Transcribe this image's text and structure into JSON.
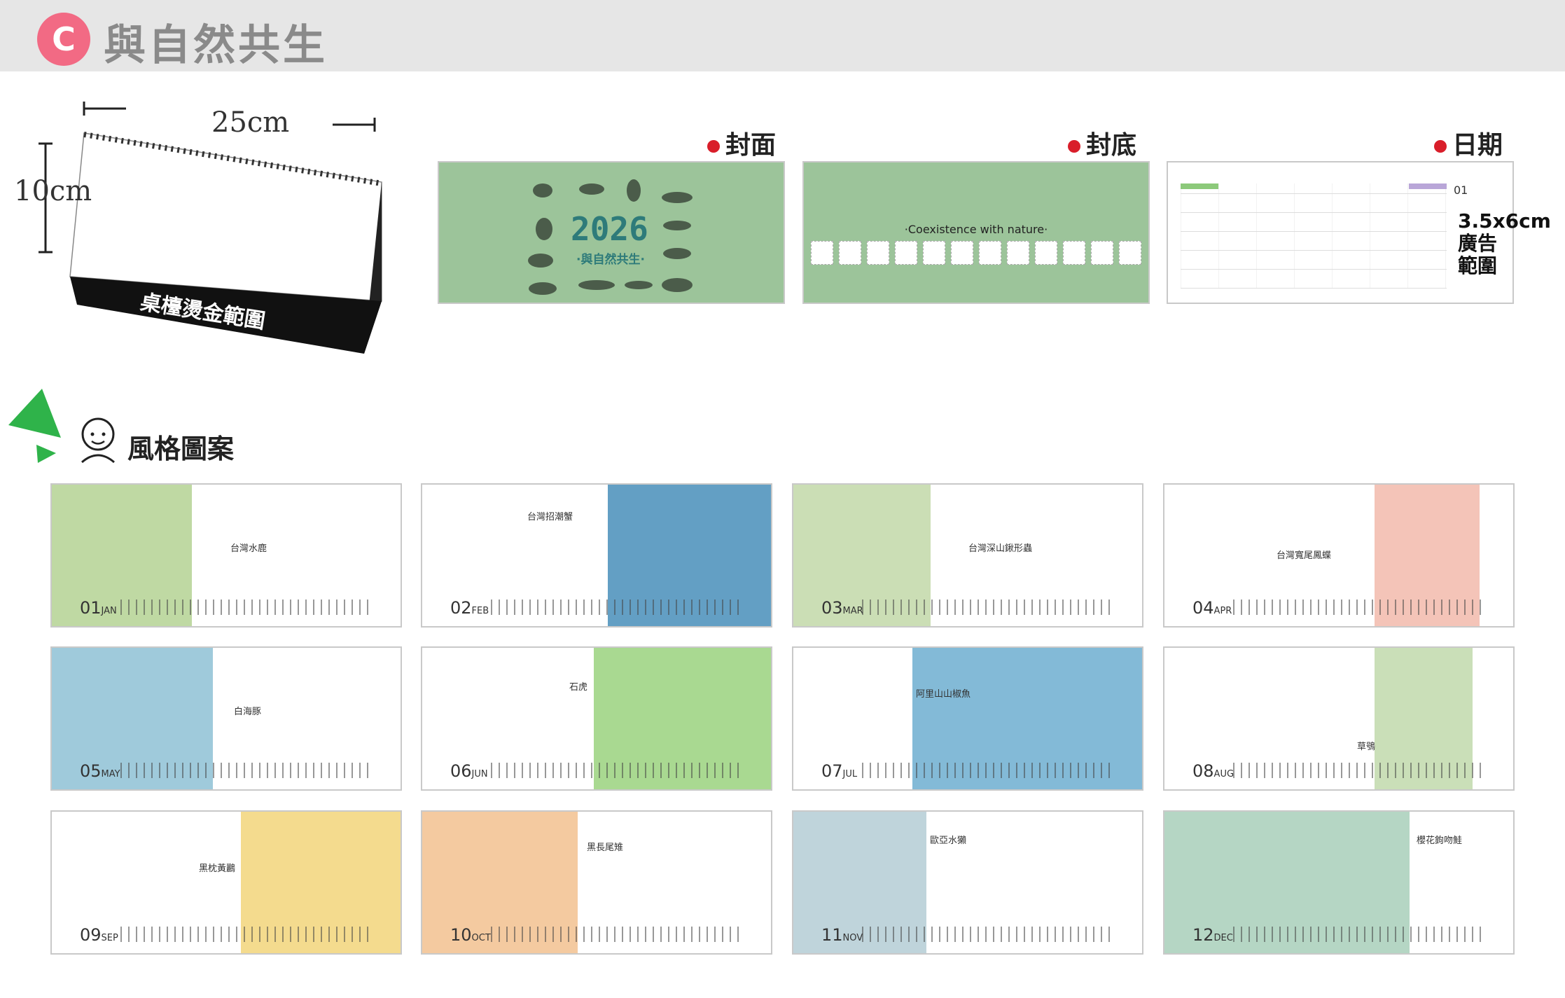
{
  "header": {
    "badge": "C",
    "title": "與自然共生"
  },
  "mockup": {
    "width_label": "25cm",
    "height_label": "10cm",
    "stamp_area_label": "桌檯燙金範圍"
  },
  "sections": {
    "cover": "封面",
    "back": "封底",
    "dates": "日期"
  },
  "cover": {
    "year": "2026",
    "subtitle": "·與自然共生·"
  },
  "back": {
    "text": "·Coexistence with nature·"
  },
  "dates_panel": {
    "month": "01",
    "ad_area": "3.5x6cm 廣告範圍"
  },
  "style_section": {
    "title": "風格圖案"
  },
  "months": [
    {
      "num": "01",
      "abbr": "JAN",
      "name": "台灣水鹿",
      "color": "#a9cc84"
    },
    {
      "num": "02",
      "abbr": "FEB",
      "name": "台灣招潮蟹",
      "color": "#2f7fb0"
    },
    {
      "num": "03",
      "abbr": "MAR",
      "name": "台灣深山鍬形蟲",
      "color": "#b9d39c"
    },
    {
      "num": "04",
      "abbr": "APR",
      "name": "台灣寬尾鳳蝶",
      "color": "#f0b0a0"
    },
    {
      "num": "05",
      "abbr": "MAY",
      "name": "白海豚",
      "color": "#7fb8cf"
    },
    {
      "num": "06",
      "abbr": "JUN",
      "name": "石虎",
      "color": "#8ccc6c"
    },
    {
      "num": "07",
      "abbr": "JUL",
      "name": "阿里山山椒魚",
      "color": "#5aa3c9"
    },
    {
      "num": "08",
      "abbr": "AUG",
      "name": "草鴞",
      "color": "#b8d4a0"
    },
    {
      "num": "09",
      "abbr": "SEP",
      "name": "黑枕黃鸝",
      "color": "#f0cf68"
    },
    {
      "num": "10",
      "abbr": "OCT",
      "name": "黑長尾雉",
      "color": "#f0b880"
    },
    {
      "num": "11",
      "abbr": "NOV",
      "name": "歐亞水獺",
      "color": "#a9c6cf"
    },
    {
      "num": "12",
      "abbr": "DEC",
      "name": "櫻花鉤吻鮭",
      "color": "#9cc8b0"
    }
  ]
}
